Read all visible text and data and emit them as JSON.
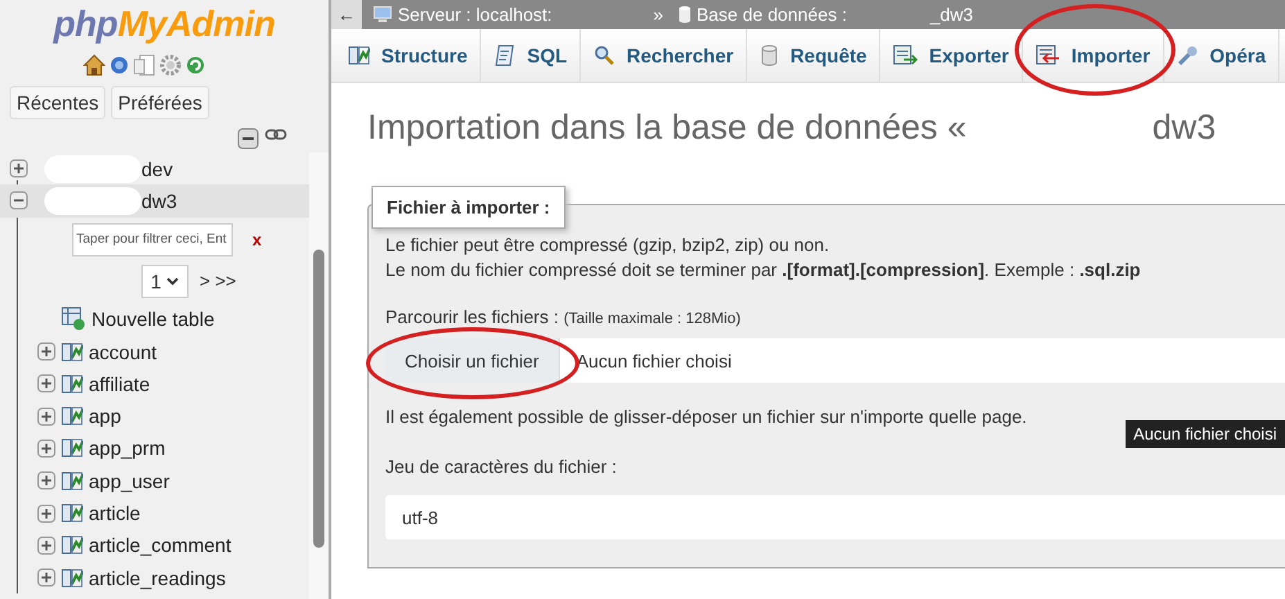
{
  "sidebar": {
    "logo": [
      "php",
      "MyAdmin"
    ],
    "buttons": [
      "Récentes",
      "Préférées"
    ],
    "tree": [
      {
        "label": "dev",
        "expanded": false,
        "redacted": true
      },
      {
        "label": "dw3",
        "expanded": true,
        "redacted": true,
        "filter_placeholder": "Taper pour filtrer ceci, Ent",
        "clear": "x",
        "page": "1",
        "page_nav": "> >>",
        "children": [
          {
            "label": "Nouvelle table",
            "kind": "new"
          },
          {
            "label": "account",
            "kind": "table"
          },
          {
            "label": "affiliate",
            "kind": "table"
          },
          {
            "label": "app",
            "kind": "table"
          },
          {
            "label": "app_prm",
            "kind": "table"
          },
          {
            "label": "app_user",
            "kind": "table"
          },
          {
            "label": "article",
            "kind": "table"
          },
          {
            "label": "article_comment",
            "kind": "table"
          },
          {
            "label": "article_readings",
            "kind": "table"
          }
        ]
      }
    ]
  },
  "breadcrumb": {
    "back": "←",
    "server": "Serveur : localhost:",
    "separator": "»",
    "database": "Base de données :",
    "db_name": "_dw3"
  },
  "tabs": [
    {
      "label": "Structure",
      "kind": "structure",
      "highlighted": false
    },
    {
      "label": "SQL",
      "kind": "sql",
      "highlighted": false
    },
    {
      "label": "Rechercher",
      "kind": "search",
      "highlighted": false
    },
    {
      "label": "Requête",
      "kind": "query",
      "highlighted": false
    },
    {
      "label": "Exporter",
      "kind": "export",
      "highlighted": false
    },
    {
      "label": "Importer",
      "kind": "import",
      "highlighted": true
    },
    {
      "label": "Opéra",
      "kind": "operations",
      "highlighted": false
    }
  ],
  "heading": {
    "title": "Importation dans la base de données «",
    "db": "dw3"
  },
  "fieldset": {
    "legend": "Fichier à importer :",
    "lines": [
      "Le fichier peut être compressé (gzip, bzip2, zip) ou non.",
      "Le nom du fichier compressé doit se terminer par **.[format].[compression]**. Exemple : **.sql.zip**"
    ],
    "browse_label": "Parcourir les fichiers :",
    "max_size": "(Taille maximale : 128Mio)",
    "file_button": {
      "label": "Choisir un fichier",
      "highlighted": true
    },
    "file_status": "Aucun fichier choisi",
    "tooltip": "Aucun fichier choisi",
    "drag_hint": "Il est également possible de glisser-déposer un fichier sur n'importe quelle page.",
    "charset_label": "Jeu de caractères du fichier :",
    "charset_value": "utf-8"
  }
}
